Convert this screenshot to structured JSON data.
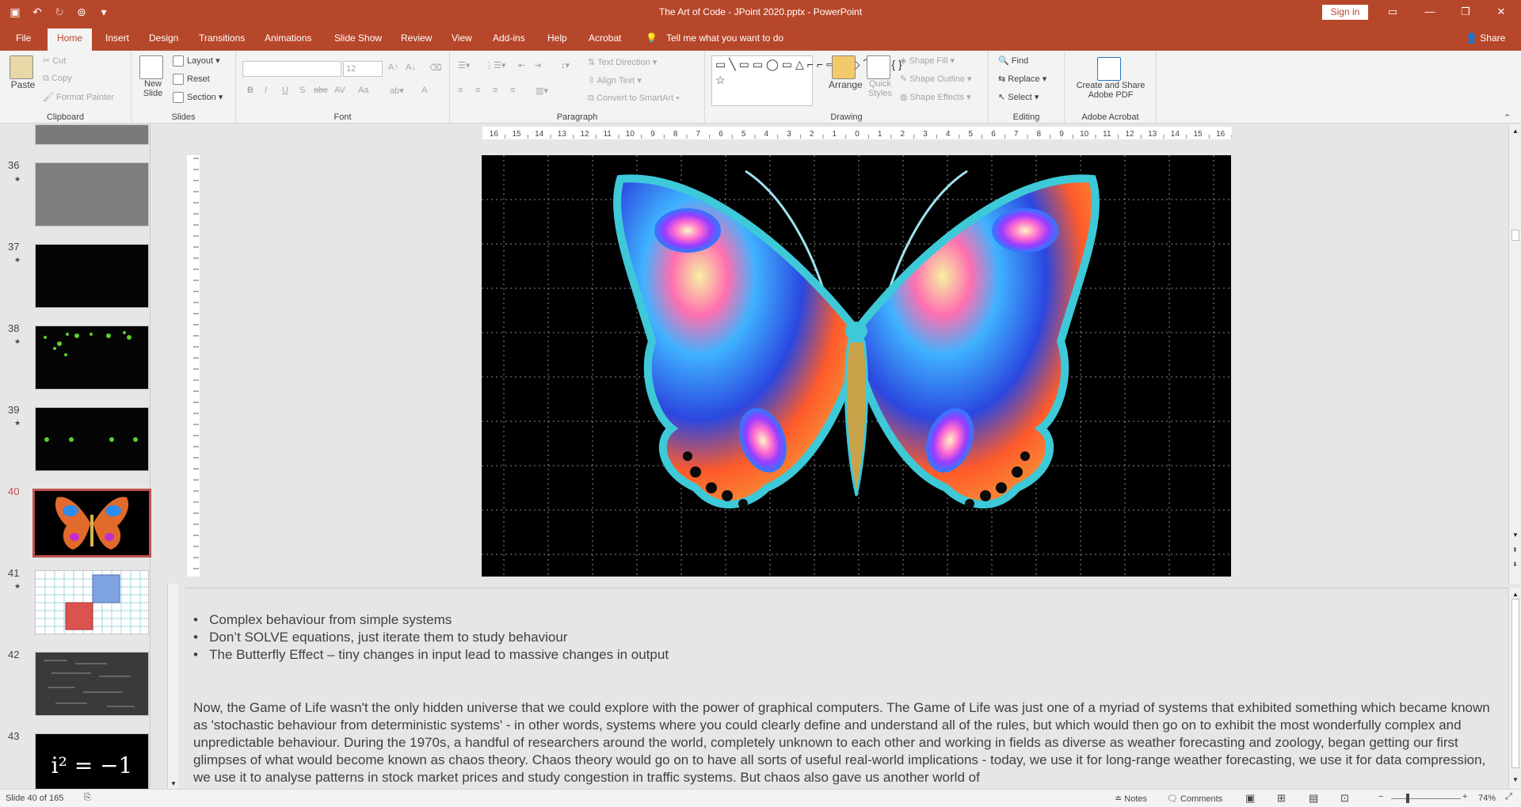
{
  "window": {
    "title": "The Art of Code - JPoint 2020.pptx  -  PowerPoint",
    "signin_label": "Sign in"
  },
  "tabs": [
    {
      "label": "File"
    },
    {
      "label": "Home"
    },
    {
      "label": "Insert"
    },
    {
      "label": "Design"
    },
    {
      "label": "Transitions"
    },
    {
      "label": "Animations"
    },
    {
      "label": "Slide Show"
    },
    {
      "label": "Review"
    },
    {
      "label": "View"
    },
    {
      "label": "Add-ins"
    },
    {
      "label": "Help"
    },
    {
      "label": "Acrobat"
    }
  ],
  "tell_me": "Tell me what you want to do",
  "share_label": "Share",
  "ribbon": {
    "clipboard": {
      "paste": "Paste",
      "cut": "Cut",
      "copy": "Copy",
      "format_painter": "Format Painter",
      "label": "Clipboard"
    },
    "slides": {
      "new_slide_1": "New",
      "new_slide_2": "Slide",
      "layout": "Layout",
      "reset": "Reset",
      "section": "Section",
      "label": "Slides"
    },
    "font": {
      "size": "12",
      "label": "Font",
      "bold": "B",
      "italic": "I",
      "underline": "U",
      "strike": "S",
      "shadow": "abc",
      "spacing": "AV",
      "case": "Aa",
      "color": "A"
    },
    "paragraph": {
      "text_direction": "Text Direction",
      "align_text": "Align Text",
      "convert_smartart": "Convert to SmartArt",
      "label": "Paragraph"
    },
    "drawing": {
      "arrange": "Arrange",
      "quick_styles_1": "Quick",
      "quick_styles_2": "Styles",
      "shape_fill": "Shape Fill",
      "shape_outline": "Shape Outline",
      "shape_effects": "Shape Effects",
      "label": "Drawing"
    },
    "editing": {
      "find": "Find",
      "replace": "Replace",
      "select": "Select",
      "label": "Editing"
    },
    "acrobat": {
      "create_1": "Create and Share",
      "create_2": "Adobe PDF",
      "label": "Adobe Acrobat"
    }
  },
  "thumbnails": [
    {
      "num": "36",
      "star": "★"
    },
    {
      "num": "37",
      "star": "★"
    },
    {
      "num": "38",
      "star": "★"
    },
    {
      "num": "39",
      "star": "★"
    },
    {
      "num": "40",
      "star": ""
    },
    {
      "num": "41",
      "star": "★"
    },
    {
      "num": "42",
      "star": ""
    },
    {
      "num": "43",
      "star": ""
    }
  ],
  "thumb_43_text": "i² = −1",
  "ruler_labels": [
    "16",
    "15",
    "14",
    "13",
    "12",
    "11",
    "10",
    "9",
    "8",
    "7",
    "6",
    "5",
    "4",
    "3",
    "2",
    "1",
    "0",
    "1",
    "2",
    "3",
    "4",
    "5",
    "6",
    "7",
    "8",
    "9",
    "10",
    "11",
    "12",
    "13",
    "14",
    "15",
    "16"
  ],
  "notes": {
    "bullets": [
      "Complex behaviour from simple systems",
      "Don’t SOLVE equations, just iterate them to study behaviour",
      "The Butterfly Effect – tiny changes in input lead to massive changes in output"
    ],
    "paragraph": "Now, the Game of Life wasn't the only hidden universe that we could explore with the power of graphical computers. The Game of Life was just one of a myriad of systems that exhibited something which became known as 'stochastic behaviour from deterministic systems' - in other words, systems where you could clearly define and understand all of the rules, but which would then go on to exhibit the most wonderfully complex and unpredictable behaviour. During the 1970s, a handful of researchers around the world, completely unknown to each other and working in fields as diverse as weather forecasting and zoology, began getting our first glimpses of what would become known as chaos theory. Chaos theory would go on to have all sorts of useful real-world implications - today, we use it for long-range weather forecasting, we use it for data compression, we use it to analyse patterns in stock market prices and study congestion in traffic systems. But chaos also gave us another world of"
  },
  "status": {
    "slide_count": "Slide 40 of 165",
    "notes": "Notes",
    "comments": "Comments",
    "zoom": "74%"
  },
  "colors": {
    "accent": "#b7472a",
    "selected_thumb": "#c0504d"
  }
}
